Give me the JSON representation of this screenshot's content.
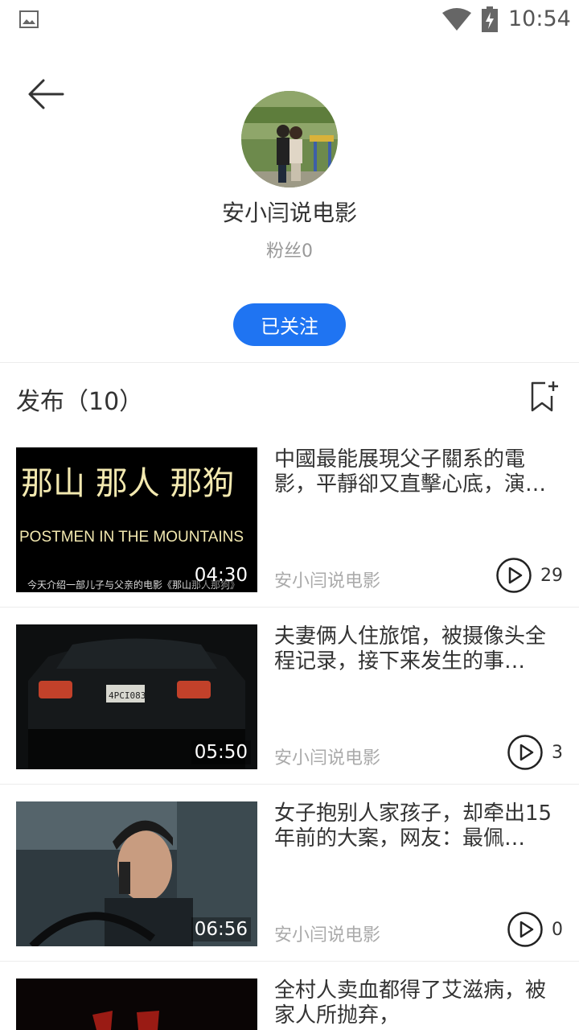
{
  "status_bar": {
    "time": "10:54"
  },
  "profile": {
    "name": "安小闫说电影",
    "followers": "粉丝0",
    "follow_label": "已关注"
  },
  "section": {
    "title": "发布（10）"
  },
  "videos": [
    {
      "title": "中國最能展現父子關系的電影，平靜卻又直擊心底，演…",
      "author": "安小闫说电影",
      "duration": "04:30",
      "plays": "29",
      "thumb_text_cn": "那山 那人 那狗",
      "thumb_text_en": "POSTMEN IN THE MOUNTAINS",
      "thumb_caption": "今天介绍一部儿子与父亲的电影《那山那人那狗》"
    },
    {
      "title": "夫妻俩人住旅馆，被摄像头全程记录，接下来发生的事…",
      "author": "安小闫说电影",
      "duration": "05:50",
      "plays": "3",
      "plate": "4PCI083"
    },
    {
      "title": "女子抱别人家孩子，却牵出15年前的大案，网友：最佩…",
      "author": "安小闫说电影",
      "duration": "06:56",
      "plays": "0"
    },
    {
      "title": "全村人卖血都得了艾滋病，被家人所抛弃，"
    }
  ]
}
